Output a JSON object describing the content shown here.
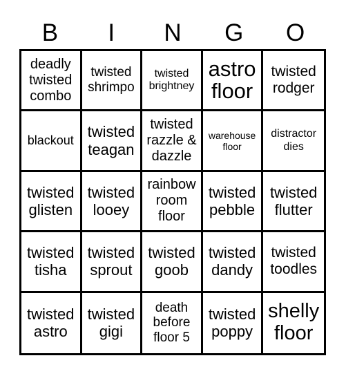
{
  "header": {
    "letters": [
      "B",
      "I",
      "N",
      "G",
      "O"
    ]
  },
  "board": {
    "rows": [
      [
        {
          "text": "deadly twisted combo"
        },
        {
          "text": "twisted shrimpo"
        },
        {
          "text": "twisted brightney"
        },
        {
          "text": "astro floor"
        },
        {
          "text": "twisted rodger"
        }
      ],
      [
        {
          "text": "blackout"
        },
        {
          "text": "twisted teagan"
        },
        {
          "text": "twisted razzle & dazzle"
        },
        {
          "text": "warehouse floor"
        },
        {
          "text": "distractor dies"
        }
      ],
      [
        {
          "text": "twisted glisten"
        },
        {
          "text": "twisted looey"
        },
        {
          "text": "rainbow room floor"
        },
        {
          "text": "twisted pebble"
        },
        {
          "text": "twisted flutter"
        }
      ],
      [
        {
          "text": "twisted tisha"
        },
        {
          "text": "twisted sprout"
        },
        {
          "text": "twisted goob"
        },
        {
          "text": "twisted dandy"
        },
        {
          "text": "twisted toodles"
        }
      ],
      [
        {
          "text": "twisted astro"
        },
        {
          "text": "twisted gigi"
        },
        {
          "text": "death before floor 5"
        },
        {
          "text": "twisted poppy"
        },
        {
          "text": "shelly floor"
        }
      ]
    ]
  }
}
